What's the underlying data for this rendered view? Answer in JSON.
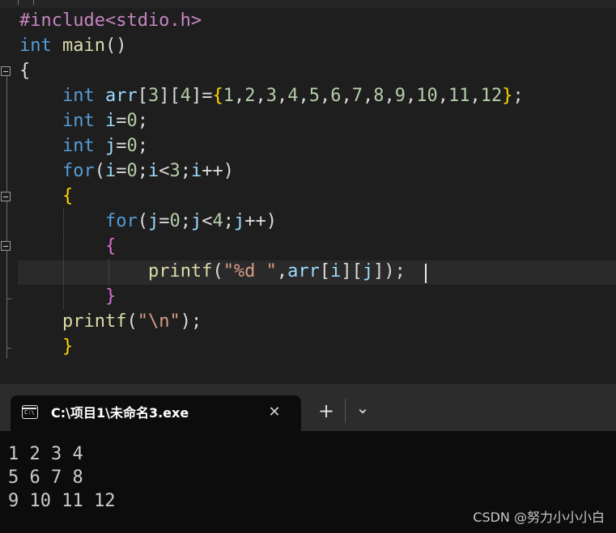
{
  "colors": {
    "editor_bg": "#1e1e1e",
    "keyword": "#569cd6",
    "preprocessor": "#c586c0",
    "function": "#dcdcaa",
    "variable": "#9cdcfe",
    "number": "#b5cea8",
    "string": "#d69d85",
    "plain": "#dcdcdc",
    "brace_level1": "#ffd700",
    "brace_level2": "#da70d6",
    "brace_level3": "#179fff",
    "terminal_bg": "#0c0c0c"
  },
  "editor": {
    "lines": [
      [
        {
          "t": "#include<stdio.h>",
          "k": "preprocessor"
        }
      ],
      [
        {
          "t": "int",
          "k": "keyword"
        },
        {
          "t": " ",
          "k": "plain"
        },
        {
          "t": "main",
          "k": "function"
        },
        {
          "t": "()",
          "k": "plain"
        }
      ],
      [
        {
          "t": "{",
          "k": "plain"
        }
      ],
      [
        {
          "t": "    ",
          "k": "plain"
        },
        {
          "t": "int",
          "k": "keyword"
        },
        {
          "t": " ",
          "k": "plain"
        },
        {
          "t": "arr",
          "k": "variable"
        },
        {
          "t": "[",
          "k": "plain"
        },
        {
          "t": "3",
          "k": "number"
        },
        {
          "t": "][",
          "k": "plain"
        },
        {
          "t": "4",
          "k": "number"
        },
        {
          "t": "]=",
          "k": "plain"
        },
        {
          "t": "{",
          "k": "brace_level1"
        },
        {
          "t": "1",
          "k": "number"
        },
        {
          "t": ",",
          "k": "plain"
        },
        {
          "t": "2",
          "k": "number"
        },
        {
          "t": ",",
          "k": "plain"
        },
        {
          "t": "3",
          "k": "number"
        },
        {
          "t": ",",
          "k": "plain"
        },
        {
          "t": "4",
          "k": "number"
        },
        {
          "t": ",",
          "k": "plain"
        },
        {
          "t": "5",
          "k": "number"
        },
        {
          "t": ",",
          "k": "plain"
        },
        {
          "t": "6",
          "k": "number"
        },
        {
          "t": ",",
          "k": "plain"
        },
        {
          "t": "7",
          "k": "number"
        },
        {
          "t": ",",
          "k": "plain"
        },
        {
          "t": "8",
          "k": "number"
        },
        {
          "t": ",",
          "k": "plain"
        },
        {
          "t": "9",
          "k": "number"
        },
        {
          "t": ",",
          "k": "plain"
        },
        {
          "t": "10",
          "k": "number"
        },
        {
          "t": ",",
          "k": "plain"
        },
        {
          "t": "11",
          "k": "number"
        },
        {
          "t": ",",
          "k": "plain"
        },
        {
          "t": "12",
          "k": "number"
        },
        {
          "t": "}",
          "k": "brace_level1"
        },
        {
          "t": ";",
          "k": "plain"
        }
      ],
      [
        {
          "t": "    ",
          "k": "plain"
        },
        {
          "t": "int",
          "k": "keyword"
        },
        {
          "t": " ",
          "k": "plain"
        },
        {
          "t": "i",
          "k": "variable"
        },
        {
          "t": "=",
          "k": "plain"
        },
        {
          "t": "0",
          "k": "number"
        },
        {
          "t": ";",
          "k": "plain"
        }
      ],
      [
        {
          "t": "    ",
          "k": "plain"
        },
        {
          "t": "int",
          "k": "keyword"
        },
        {
          "t": " ",
          "k": "plain"
        },
        {
          "t": "j",
          "k": "variable"
        },
        {
          "t": "=",
          "k": "plain"
        },
        {
          "t": "0",
          "k": "number"
        },
        {
          "t": ";",
          "k": "plain"
        }
      ],
      [
        {
          "t": "    ",
          "k": "plain"
        },
        {
          "t": "for",
          "k": "keyword"
        },
        {
          "t": "(",
          "k": "plain"
        },
        {
          "t": "i",
          "k": "variable"
        },
        {
          "t": "=",
          "k": "plain"
        },
        {
          "t": "0",
          "k": "number"
        },
        {
          "t": ";",
          "k": "plain"
        },
        {
          "t": "i",
          "k": "variable"
        },
        {
          "t": "<",
          "k": "plain"
        },
        {
          "t": "3",
          "k": "number"
        },
        {
          "t": ";",
          "k": "plain"
        },
        {
          "t": "i",
          "k": "variable"
        },
        {
          "t": "++)",
          "k": "plain"
        }
      ],
      [
        {
          "t": "    ",
          "k": "plain"
        },
        {
          "t": "{",
          "k": "brace_level1"
        }
      ],
      [
        {
          "t": "        ",
          "k": "plain"
        },
        {
          "t": "for",
          "k": "keyword"
        },
        {
          "t": "(",
          "k": "plain"
        },
        {
          "t": "j",
          "k": "variable"
        },
        {
          "t": "=",
          "k": "plain"
        },
        {
          "t": "0",
          "k": "number"
        },
        {
          "t": ";",
          "k": "plain"
        },
        {
          "t": "j",
          "k": "variable"
        },
        {
          "t": "<",
          "k": "plain"
        },
        {
          "t": "4",
          "k": "number"
        },
        {
          "t": ";",
          "k": "plain"
        },
        {
          "t": "j",
          "k": "variable"
        },
        {
          "t": "++)",
          "k": "plain"
        }
      ],
      [
        {
          "t": "        ",
          "k": "plain"
        },
        {
          "t": "{",
          "k": "brace_level2"
        }
      ],
      [
        {
          "t": "            ",
          "k": "plain"
        },
        {
          "t": "printf",
          "k": "function"
        },
        {
          "t": "(",
          "k": "plain"
        },
        {
          "t": "\"%d \"",
          "k": "string"
        },
        {
          "t": ",",
          "k": "plain"
        },
        {
          "t": "arr",
          "k": "variable"
        },
        {
          "t": "[",
          "k": "plain"
        },
        {
          "t": "i",
          "k": "variable"
        },
        {
          "t": "][",
          "k": "plain"
        },
        {
          "t": "j",
          "k": "variable"
        },
        {
          "t": "]);",
          "k": "plain"
        }
      ],
      [
        {
          "t": "        ",
          "k": "plain"
        },
        {
          "t": "}",
          "k": "brace_level2"
        }
      ],
      [
        {
          "t": "    ",
          "k": "plain"
        },
        {
          "t": "printf",
          "k": "function"
        },
        {
          "t": "(",
          "k": "plain"
        },
        {
          "t": "\"\\n\"",
          "k": "string"
        },
        {
          "t": ");",
          "k": "plain"
        }
      ],
      [
        {
          "t": "    ",
          "k": "plain"
        },
        {
          "t": "}",
          "k": "brace_level1"
        }
      ]
    ]
  },
  "terminal": {
    "tab_title": "C:\\项目1\\未命名3.exe",
    "tab_icon": "terminal-icon",
    "close_symbol": "✕",
    "new_tab_symbol": "+",
    "dropdown_symbol": "⌄",
    "output": [
      "1 2 3 4",
      "5 6 7 8",
      "9 10 11 12"
    ]
  },
  "watermark": "CSDN @努力小小小白"
}
